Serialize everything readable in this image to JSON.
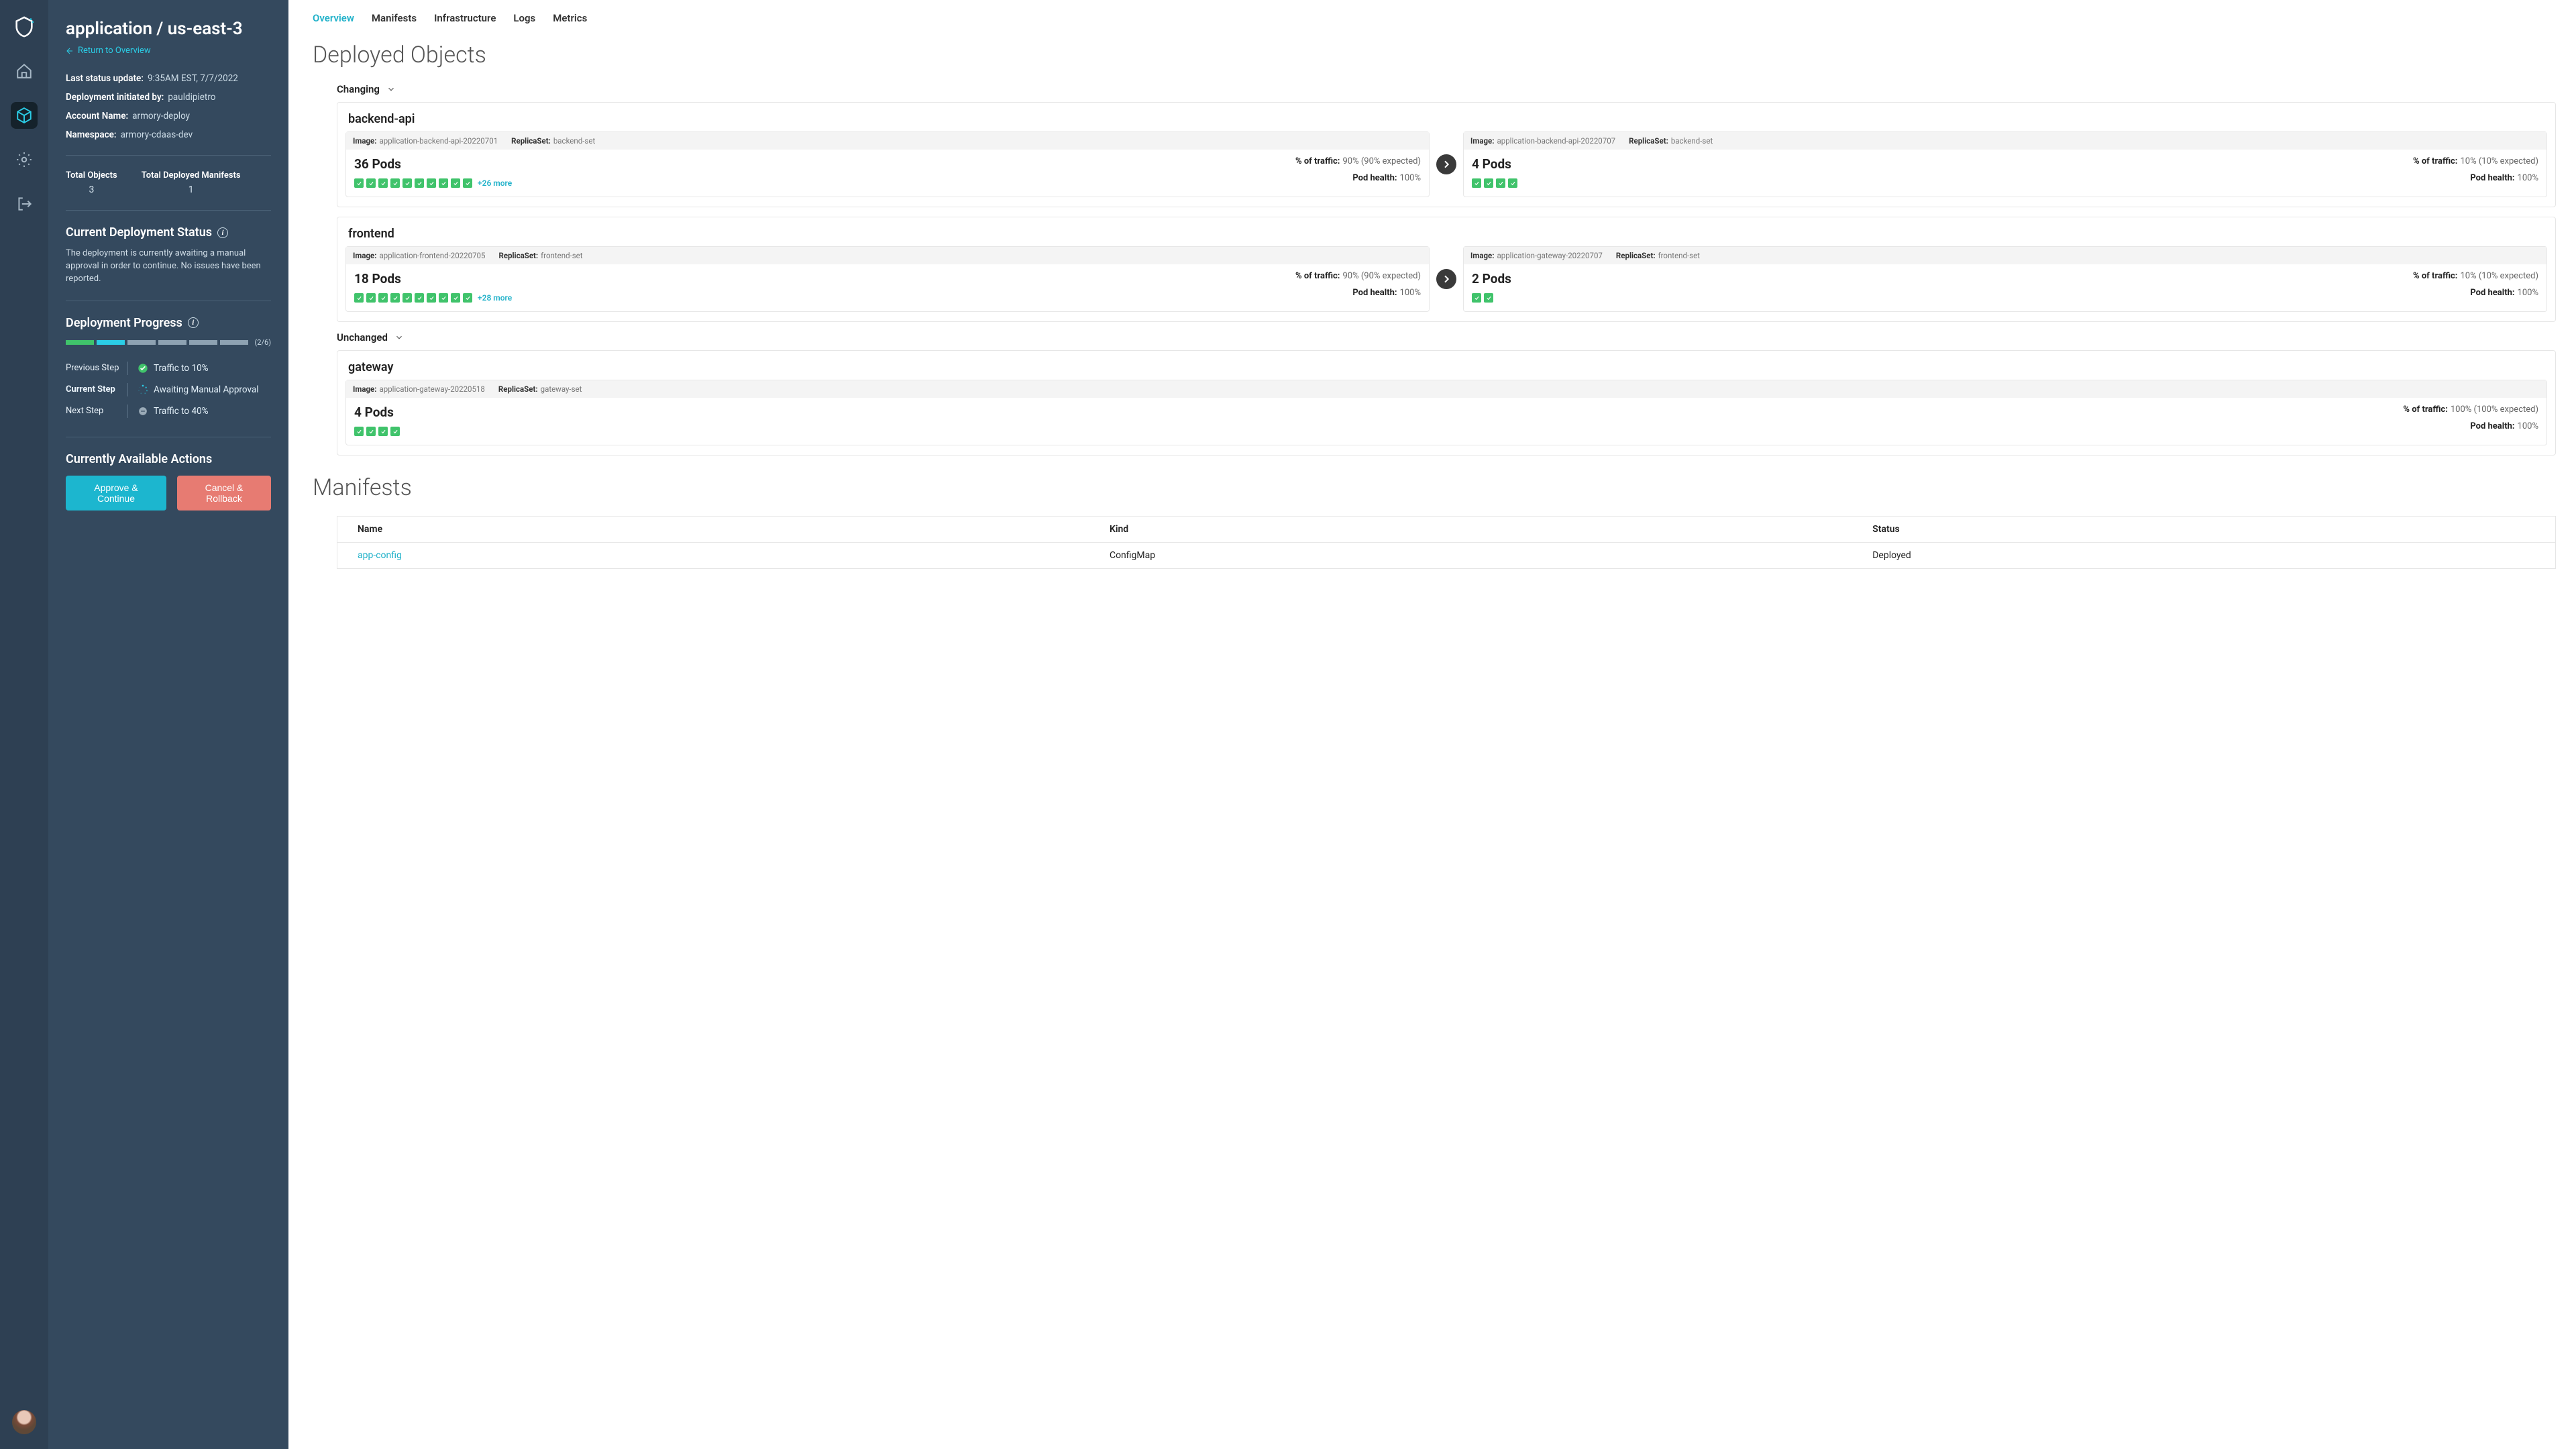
{
  "title": "application / us-east-3",
  "backlink": "Return to Overview",
  "meta": {
    "status_update_k": "Last status update:",
    "status_update_v": "9:35AM EST, 7/7/2022",
    "initiated_k": "Deployment initiated by:",
    "initiated_v": "pauldipietro",
    "account_k": "Account Name:",
    "account_v": "armory-deploy",
    "namespace_k": "Namespace:",
    "namespace_v": "armory-cdaas-dev"
  },
  "totals": {
    "objects_k": "Total Objects",
    "objects_v": "3",
    "manifests_k": "Total Deployed Manifests",
    "manifests_v": "1"
  },
  "status": {
    "heading": "Current Deployment Status",
    "text": "The deployment is currently awaiting a manual approval in order to continue. No issues have been reported."
  },
  "progress": {
    "heading": "Deployment Progress",
    "frac": "(2/6)",
    "prev_k": "Previous Step",
    "prev_v": "Traffic to 10%",
    "cur_k": "Current Step",
    "cur_v": "Awaiting Manual Approval",
    "next_k": "Next Step",
    "next_v": "Traffic to 40%"
  },
  "actions": {
    "heading": "Currently Available Actions",
    "approve": "Approve & Continue",
    "cancel": "Cancel & Rollback"
  },
  "tabs": [
    "Overview",
    "Manifests",
    "Infrastructure",
    "Logs",
    "Metrics"
  ],
  "main": {
    "deployed_heading": "Deployed Objects",
    "changing": "Changing",
    "unchanged": "Unchanged",
    "manifests_heading": "Manifests"
  },
  "labels": {
    "image": "Image:",
    "replicaset": "ReplicaSet:",
    "traffic": "% of traffic:",
    "health": "Pod health:"
  },
  "cards": {
    "backend": {
      "name": "backend-api",
      "left": {
        "image": "application-backend-api-20220701",
        "rs": "backend-set",
        "pods": "36 Pods",
        "traffic": "90% (90% expected)",
        "health": "100%",
        "shown": 10,
        "more": "+26 more"
      },
      "right": {
        "image": "application-backend-api-20220707",
        "rs": "backend-set",
        "pods": "4 Pods",
        "traffic": "10% (10% expected)",
        "health": "100%",
        "shown": 4
      }
    },
    "frontend": {
      "name": "frontend",
      "left": {
        "image": "application-frontend-20220705",
        "rs": "frontend-set",
        "pods": "18 Pods",
        "traffic": "90% (90% expected)",
        "health": "100%",
        "shown": 10,
        "more": "+28 more"
      },
      "right": {
        "image": "application-gateway-20220707",
        "rs": "frontend-set",
        "pods": "2 Pods",
        "traffic": "10% (10% expected)",
        "health": "100%",
        "shown": 2
      }
    },
    "gateway": {
      "name": "gateway",
      "only": {
        "image": "application-gateway-20220518",
        "rs": "gateway-set",
        "pods": "4 Pods",
        "traffic": "100% (100% expected)",
        "health": "100%",
        "shown": 4
      }
    }
  },
  "manifest_table": {
    "h1": "Name",
    "h2": "Kind",
    "h3": "Status",
    "r1c1": "app-config",
    "r1c2": "ConfigMap",
    "r1c3": "Deployed"
  }
}
